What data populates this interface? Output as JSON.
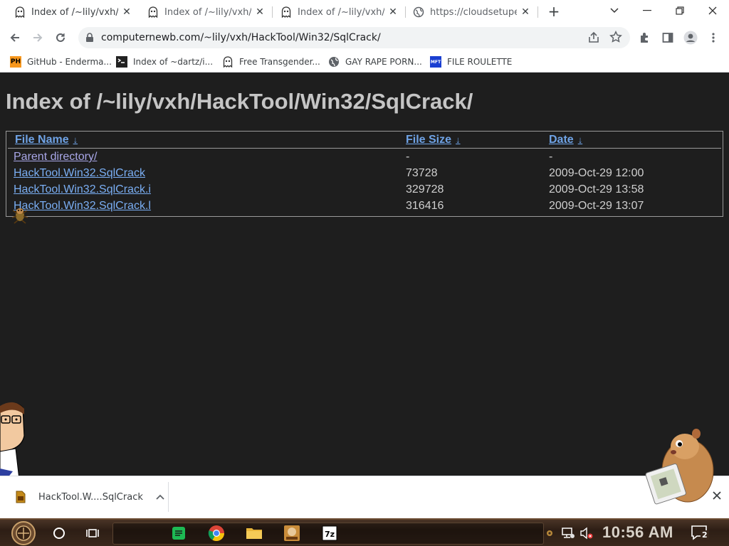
{
  "browser": {
    "tabs": [
      {
        "title": "Index of /~lily/vxh/H",
        "active": true
      },
      {
        "title": "Index of /~lily/vxh/R",
        "active": false
      },
      {
        "title": "Index of /~lily/vxh/R",
        "active": false
      },
      {
        "title": "https://cloudsetupe.f",
        "active": false
      }
    ],
    "new_tab_label": "+",
    "url": "computernewb.com/~lily/vxh/HackTool/Win32/SqlCrack/",
    "bookmarks": [
      {
        "icon": "ph-icon",
        "badge": "PH",
        "label": "GitHub - Enderma..."
      },
      {
        "icon": "terminal-icon",
        "badge": "",
        "label": "Index of ~dartz/i..."
      },
      {
        "icon": "user-icon",
        "badge": "",
        "label": "Free Transgender..."
      },
      {
        "icon": "globe-icon",
        "badge": "",
        "label": "GAY RAPE PORN..."
      },
      {
        "icon": "mft-icon",
        "badge": "MFT",
        "label": "FILE ROULETTE"
      }
    ]
  },
  "page": {
    "title": "Index of /~lily/vxh/HackTool/Win32/SqlCrack/",
    "columns": {
      "name": "File Name",
      "size": "File Size",
      "date": "Date",
      "sort_arrow": "↓"
    },
    "rows": [
      {
        "name": "Parent directory/",
        "size": "-",
        "date": "-"
      },
      {
        "name": "HackTool.Win32.SqlCrack",
        "size": "73728",
        "date": "2009-Oct-29 12:00"
      },
      {
        "name": "HackTool.Win32.SqlCrack.i",
        "size": "329728",
        "date": "2009-Oct-29 13:58"
      },
      {
        "name": "HackTool.Win32.SqlCrack.l",
        "size": "316416",
        "date": "2009-Oct-29 13:07"
      }
    ]
  },
  "downloads": {
    "item_name": "HackTool.W....SqlCrack"
  },
  "taskbar": {
    "clock": "10:56 AM",
    "notification_count": "2"
  },
  "colors": {
    "page_bg": "#1e1e1e",
    "link": "#7aaef3",
    "visited_link": "#a9a7e8",
    "heading": "#c5c5c5"
  }
}
